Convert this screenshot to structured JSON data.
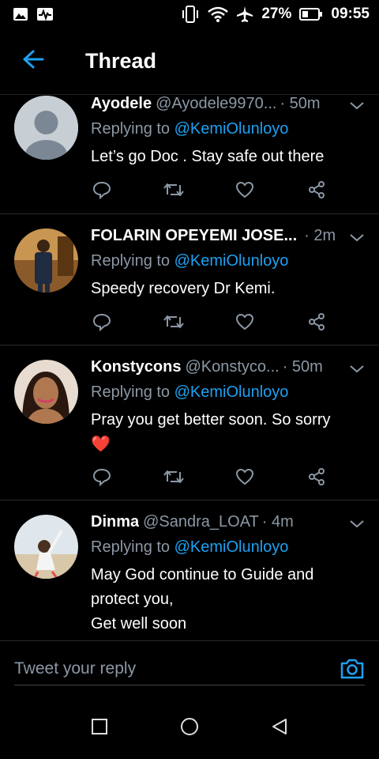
{
  "status_bar": {
    "battery": "27%",
    "time": "09:55",
    "icons": [
      "gallery-icon",
      "activity-icon",
      "vibrate-icon",
      "wifi-icon",
      "airplane-icon",
      "battery-icon"
    ]
  },
  "header": {
    "title": "Thread",
    "back_icon": "arrow-left-icon"
  },
  "tweets": [
    {
      "name": "Ayodele",
      "handle": "@Ayodele9970...",
      "time": "· 50m",
      "replying_label": "Replying to",
      "mention": "@KemiOlunloyo",
      "text": "Let’s go Doc . Stay safe out there",
      "avatar": "default-avatar"
    },
    {
      "name": "FOLARIN OPEYEMI JOSE...",
      "handle": "",
      "time": "· 2m",
      "replying_label": "Replying to",
      "mention": "@KemiOlunloyo",
      "text": "Speedy recovery Dr Kemi.",
      "avatar": "photo-avatar"
    },
    {
      "name": "Konstycons",
      "handle": "@Konstyco...",
      "time": "· 50m",
      "replying_label": "Replying to",
      "mention": "@KemiOlunloyo",
      "text": "Pray you get better soon. So sorry",
      "emoji": "❤️",
      "avatar": "photo-avatar"
    },
    {
      "name": "Dinma",
      "handle": "@Sandra_LOAT",
      "time": "· 4m",
      "replying_label": "Replying to",
      "mention": "@KemiOlunloyo",
      "text_lines": [
        "May God continue to Guide and",
        "protect you,",
        "Get well soon"
      ],
      "avatar": "photo-avatar"
    }
  ],
  "composer": {
    "placeholder": "Tweet your reply",
    "camera_icon": "camera-icon"
  },
  "colors": {
    "accent": "#1da1f2",
    "muted": "#8b98a5",
    "background": "#000000"
  }
}
